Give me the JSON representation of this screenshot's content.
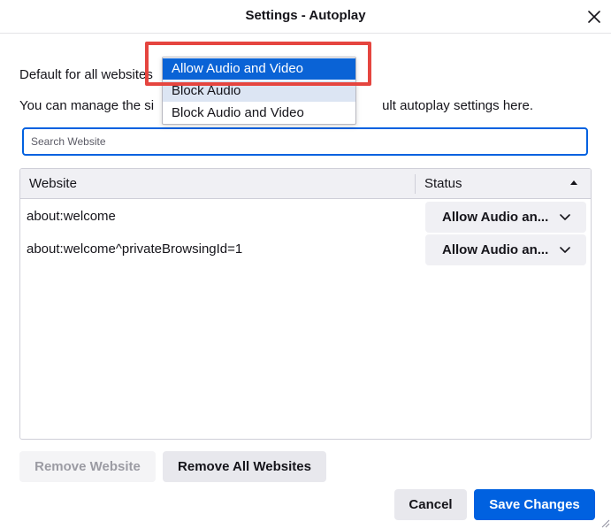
{
  "dialog": {
    "title": "Settings - Autoplay"
  },
  "default_setting": {
    "label": "Default for all websites",
    "options": [
      "Allow Audio and Video",
      "Block Audio",
      "Block Audio and Video"
    ],
    "selected": "Allow Audio and Video"
  },
  "description": "You can manage the site-specific autoplay settings here. Set the default autoplay settings here.",
  "description_visible": {
    "left": "You can manage the si",
    "right": "ult autoplay settings here."
  },
  "search": {
    "placeholder": "Search Website",
    "value": ""
  },
  "table": {
    "headers": {
      "website": "Website",
      "status": "Status"
    },
    "sort": "descending",
    "rows": [
      {
        "website": "about:welcome",
        "status": "Allow Audio an..."
      },
      {
        "website": "about:welcome^privateBrowsingId=1",
        "status": "Allow Audio an..."
      }
    ]
  },
  "buttons": {
    "remove_website": "Remove Website",
    "remove_all": "Remove All Websites",
    "cancel": "Cancel",
    "save": "Save Changes"
  },
  "colors": {
    "accent": "#0061e0",
    "highlight": "#e5453f",
    "selected_option": "#0a63d6"
  },
  "icons": {
    "close": "close-icon",
    "sort": "sort-ascending-icon",
    "chevron": "chevron-down-icon",
    "resize": "resize-grip-icon"
  }
}
